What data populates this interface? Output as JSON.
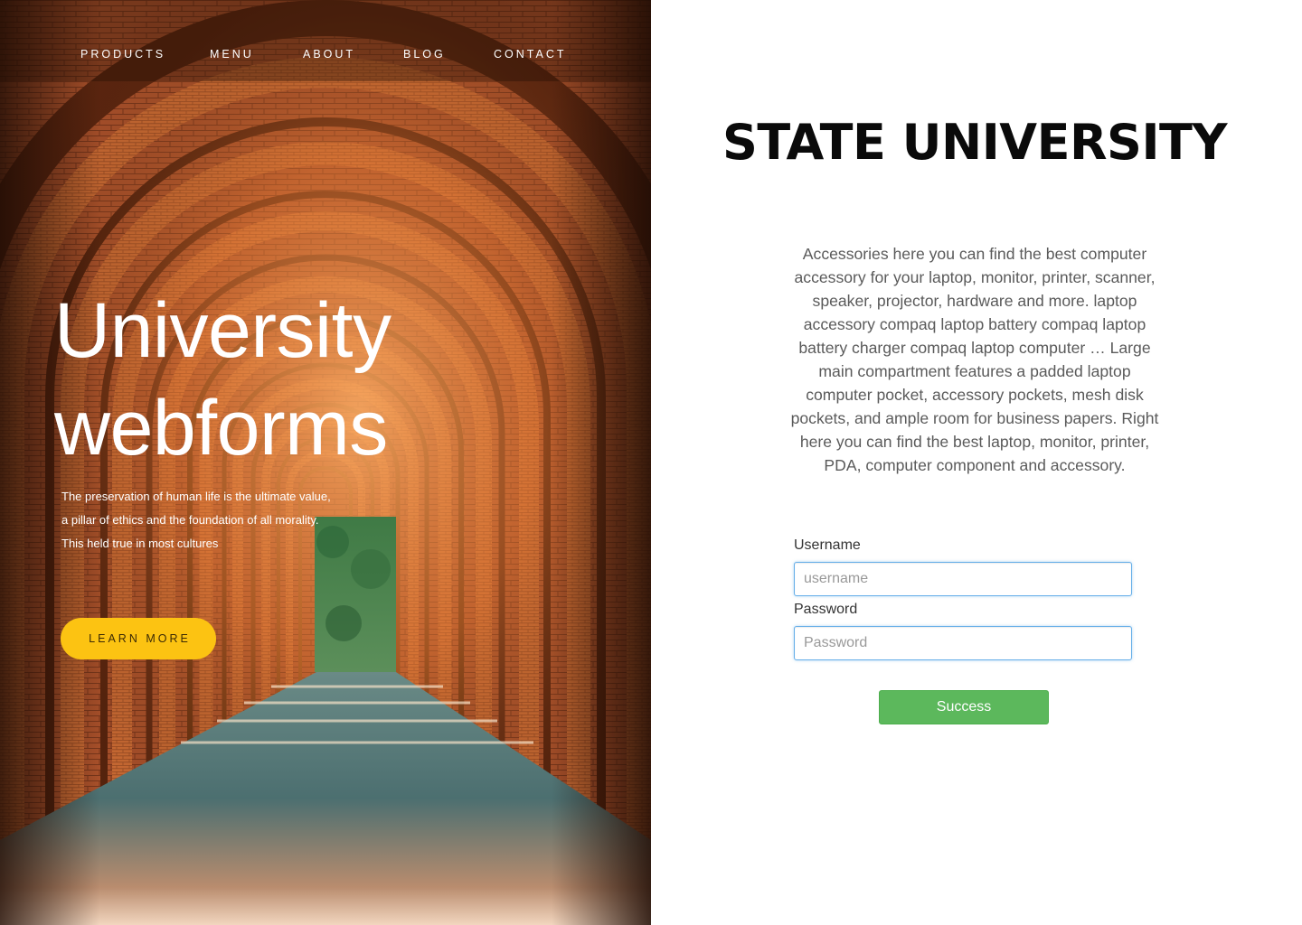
{
  "nav": {
    "items": [
      {
        "label": "PRODUCTS"
      },
      {
        "label": "MENU"
      },
      {
        "label": "ABOUT"
      },
      {
        "label": "BLOG"
      },
      {
        "label": "CONTACT"
      }
    ]
  },
  "hero": {
    "title_line1": "University",
    "title_line2": "webforms",
    "description": "The preservation of human life is the ultimate value, a pillar of ethics and the foundation of all morality. This held true in most cultures",
    "cta_label": "LEARN MORE"
  },
  "panel": {
    "brand": "STATE UNIVERSITY",
    "about": "Accessories here you can find the best computer accessory for your laptop, monitor, printer, scanner, speaker, projector, hardware and more. laptop accessory compaq laptop battery compaq laptop battery charger compaq laptop computer … Large main compartment features a padded laptop computer pocket, accessory pockets, mesh disk pockets, and ample room for business papers. Right here you can find the best laptop, monitor, printer, PDA, computer component and accessory.",
    "form": {
      "username_label": "Username",
      "username_placeholder": "username",
      "username_value": "",
      "password_label": "Password",
      "password_placeholder": "Password",
      "password_value": "",
      "submit_label": "Success"
    }
  },
  "colors": {
    "cta_bg": "#fcc312",
    "submit_bg": "#5cb85c",
    "input_border": "#66afe9",
    "brick": "#b0562a"
  }
}
